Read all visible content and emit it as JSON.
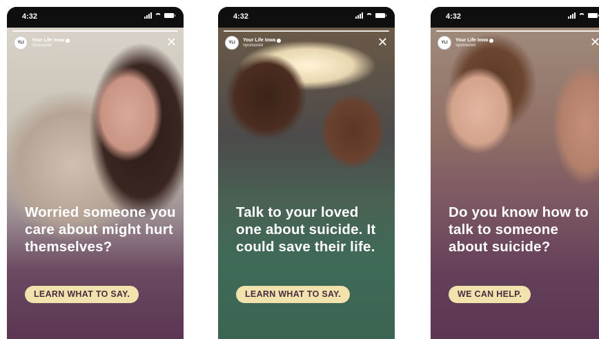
{
  "phones": [
    {
      "status_time": "4:32",
      "account_name": "Your Life Iowa",
      "sponsored": "Sponsored",
      "headline": "Worried someone you care about might hurt themselves?",
      "cta": "LEARN WHAT TO SAY."
    },
    {
      "status_time": "4:32",
      "account_name": "Your Life Iowa",
      "sponsored": "Sponsored",
      "headline": "Talk to your loved one about suicide. It could save their life.",
      "cta": "LEARN WHAT TO SAY."
    },
    {
      "status_time": "4:32",
      "account_name": "Your Life Iowa",
      "sponsored": "Sponsored",
      "headline": "Do you know how to talk to someone about suicide?",
      "cta": "WE CAN HELP."
    }
  ],
  "icons": {
    "close": "close-icon",
    "verified": "verified-badge-icon",
    "logo": "your-life-iowa-logo"
  },
  "colors": {
    "purple_overlay": "#5a3652",
    "green_overlay": "#3b6552",
    "cta_bg": "#f2e2ad",
    "cta_text": "#4a2b3f"
  }
}
